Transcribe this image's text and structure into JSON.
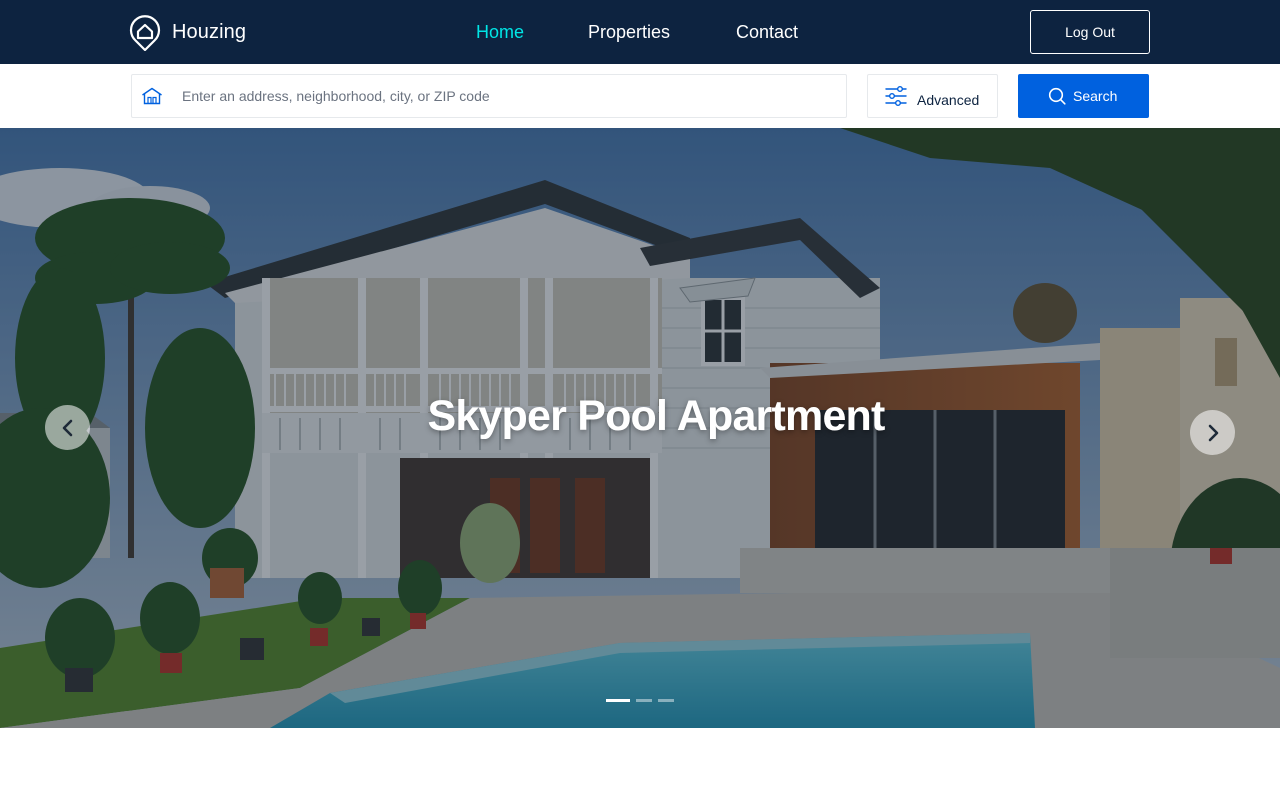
{
  "nav": {
    "brand": "Houzing",
    "links": [
      {
        "label": "Home",
        "active": true
      },
      {
        "label": "Properties",
        "active": false
      },
      {
        "label": "Contact",
        "active": false
      }
    ],
    "logout_label": "Log Out"
  },
  "search": {
    "placeholder": "Enter an address, neighborhood, city, or ZIP code",
    "advanced_label": "Advanced",
    "button_label": "Search"
  },
  "hero": {
    "title": "Skyper Pool Apartment",
    "slide_count": 3,
    "active_slide": 1
  },
  "colors": {
    "navbar_bg": "#0d2340",
    "active_link": "#00e6e6",
    "primary": "#0061df"
  },
  "icons": {
    "brand": "house-pin-icon",
    "search_field": "house-icon",
    "advanced": "sliders-icon",
    "search_button": "search-icon",
    "prev": "chevron-left-icon",
    "next": "chevron-right-icon"
  }
}
